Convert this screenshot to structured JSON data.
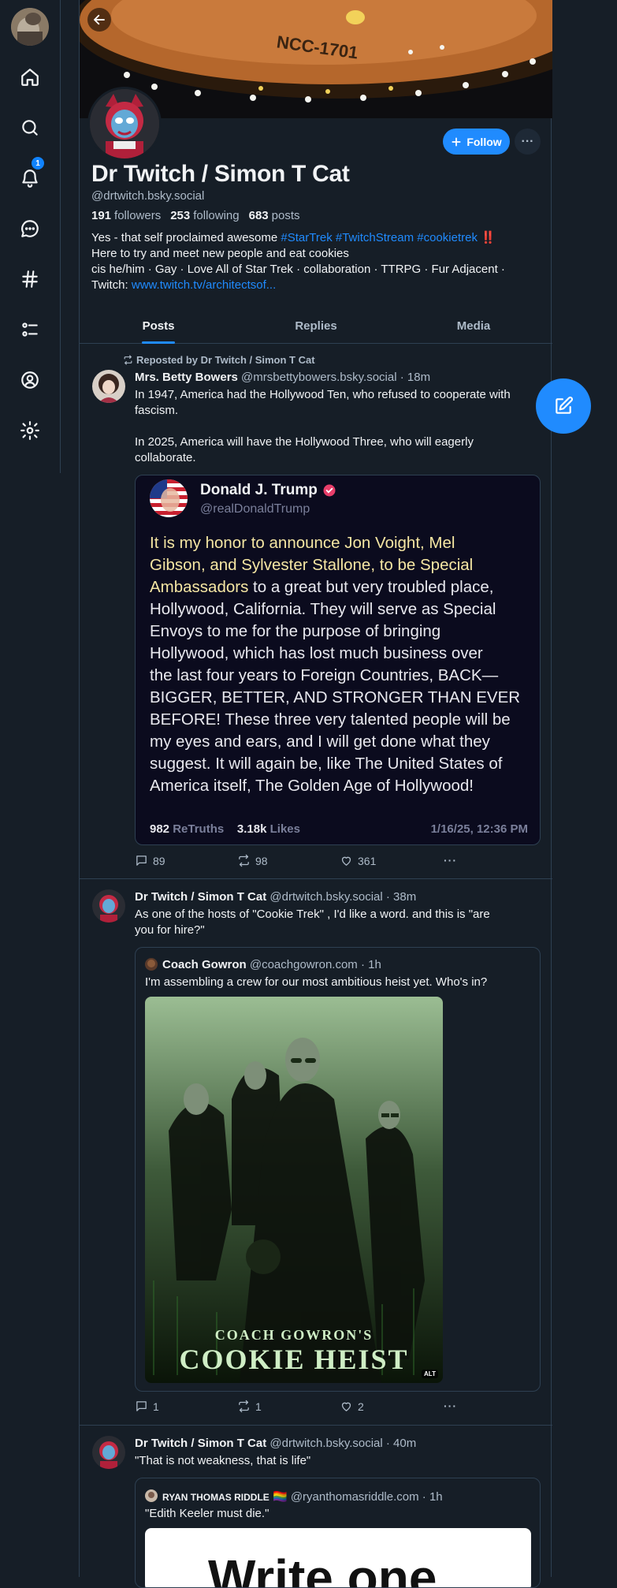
{
  "sidebar": {
    "notification_count": "1"
  },
  "profile": {
    "display_name": "Dr Twitch / Simon T Cat",
    "handle": "@drtwitch.bsky.social",
    "followers_count": "191",
    "followers_label": "followers",
    "following_count": "253",
    "following_label": "following",
    "posts_count": "683",
    "posts_label": "posts",
    "follow_label": "Follow",
    "bio": {
      "line1_prefix": "Yes - that self proclaimed awesome ",
      "tag1": "#StarTrek",
      "tag2": "#TwitchStream",
      "tag3": "#cookietrek",
      "line1_suffix": " ‼️",
      "line2": "Here to try and meet new people and eat cookies",
      "line3": "cis he/him · Gay · Love All of Star Trek ·  collaboration · TTRPG · Fur Adjacent ·",
      "line4_prefix": "Twitch: ",
      "link": "www.twitch.tv/architectsof..."
    },
    "banner_text": "NCC-1701"
  },
  "tabs": [
    {
      "label": "Posts"
    },
    {
      "label": "Replies"
    },
    {
      "label": "Media"
    }
  ],
  "posts": [
    {
      "repost_label": "Reposted by Dr Twitch / Simon T Cat",
      "author": "Mrs. Betty Bowers",
      "meta": "@mrsbettybowers.bsky.social · 18m",
      "text_1": "In 1947, America had the Hollywood Ten, who refused to cooperate with",
      "text_2": "fascism.",
      "text_3": "In 2025, America will have the Hollywood Three, who will eagerly",
      "text_4": "collaborate.",
      "embed": {
        "name": "Donald J. Trump",
        "handle": "@realDonaldTrump",
        "highlight_1": "It is my honor to announce Jon Voight, Mel",
        "highlight_2": "Gibson, and Sylvester Stallone, to be Special",
        "highlight_3": "Ambassadors",
        "body_3": " to a great but very troubled place,",
        "line_4": "Hollywood, California. They will serve as Special",
        "line_5": "Envoys to me for the purpose of bringing",
        "line_6": "Hollywood, which has lost much business over",
        "line_7": "the last four years to Foreign Countries, BACK—",
        "line_8": "BIGGER, BETTER, AND STRONGER THAN EVER",
        "line_9": "BEFORE! These three very talented people will be",
        "line_10": "my eyes and ears, and I will get done what they",
        "line_11": "suggest. It will again be, like The United States of",
        "line_12": "America itself, The Golden Age of Hollywood!",
        "retruths_count": "982",
        "retruths_label": "ReTruths",
        "likes_count": "3.18k",
        "likes_label": "Likes",
        "date": "1/16/25, 12:36 PM"
      },
      "replies": "89",
      "reposts": "98",
      "likes": "361"
    },
    {
      "author": "Dr Twitch / Simon T Cat",
      "meta": "@drtwitch.bsky.social · 38m",
      "text_1": "As one of the hosts of \"Cookie Trek\" , I'd like a word.  and this is \"are",
      "text_2": "you for hire?\"",
      "quote": {
        "author": "Coach Gowron",
        "meta": "@coachgowron.com · 1h",
        "text": "I'm assembling a crew for our most ambitious heist yet. Who's in?",
        "image_caption_1": "COACH GOWRON'S",
        "image_caption_2": "COOKIE HEIST",
        "alt_badge": "ALT"
      },
      "replies": "1",
      "reposts": "1",
      "likes": "2"
    },
    {
      "author": "Dr Twitch / Simon T Cat",
      "meta": "@drtwitch.bsky.social · 40m",
      "text_1": "\"That is not weakness, that is life\"",
      "quote": {
        "author": "RYAN THOMAS RIDDLE",
        "flag": "🏳️‍🌈",
        "meta": "@ryanthomasriddle.com · 1h",
        "text": "\"Edith Keeler must die.\"",
        "image_text": "Write one"
      }
    }
  ],
  "colors": {
    "background": "#161e27",
    "accent": "#208bfe",
    "border": "#2e4052",
    "muted_text": "#aebbc9"
  }
}
